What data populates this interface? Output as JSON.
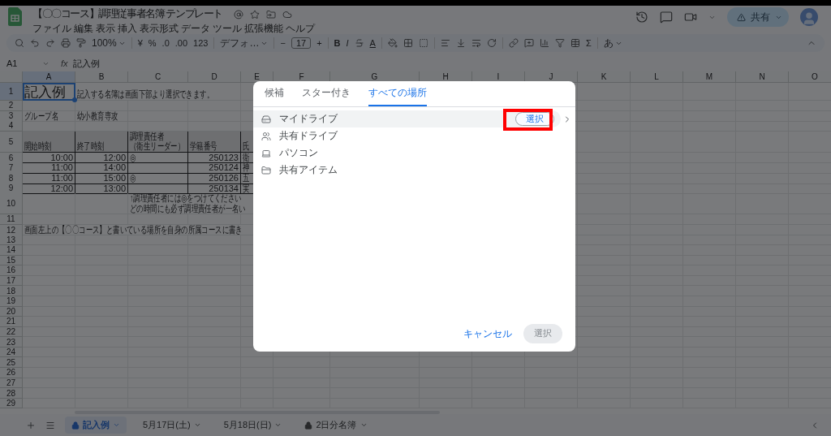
{
  "app": {
    "title": "【〇〇コース】調理従事者名簿 テンプレート",
    "menu": [
      "ファイル",
      "編集",
      "表示",
      "挿入",
      "表示形式",
      "データ",
      "ツール",
      "拡張機能",
      "ヘルプ"
    ],
    "share_button": "共有"
  },
  "toolbar": {
    "zoom": "100%",
    "currency": "¥",
    "percent": "%",
    "decimal_decrease": ".0",
    "decimal_increase": ".00",
    "number_format": "123",
    "font": "デフォ…",
    "size_decrease": "−",
    "font_size": "17",
    "size_increase": "+",
    "bold": "B",
    "italic": "I",
    "text_color": "A",
    "sum": "Σ",
    "input_tools": "あ"
  },
  "formula_bar": {
    "name_box": "A1",
    "fx": "fx",
    "value": "記入例"
  },
  "grid": {
    "columns": [
      "A",
      "B",
      "C",
      "D",
      "E",
      "F",
      "G",
      "H",
      "I",
      "J",
      "K",
      "L",
      "M",
      "N",
      "O"
    ],
    "rows": [
      {
        "number": "1",
        "kind": "plain",
        "cells": [
          {
            "kind": "title",
            "lines": [
              "記入例"
            ],
            "selected": true
          },
          {
            "kind": "text",
            "lines": [
              "記入する名簿は画面下部より選択できます。"
            ],
            "selected": false
          }
        ]
      },
      {
        "number": "2",
        "kind": "plain",
        "cells": []
      },
      {
        "number": "3",
        "kind": "plain",
        "cells": [
          {
            "kind": "text",
            "lines": [
              "グループ名"
            ],
            "selected": false
          },
          {
            "kind": "text",
            "lines": [
              "幼小教育専攻"
            ],
            "selected": false
          }
        ]
      },
      {
        "number": "4",
        "kind": "plain",
        "cells": []
      },
      {
        "number": "5",
        "kind": "table_header",
        "cells": [
          {
            "kind": "text",
            "lines": [
              "開始時刻"
            ],
            "selected": false
          },
          {
            "kind": "text",
            "lines": [
              "終了時刻"
            ],
            "selected": false
          },
          {
            "kind": "text",
            "lines": [
              "調理責任者",
              "（衛生リーダー）"
            ],
            "selected": false
          },
          {
            "kind": "text",
            "lines": [
              "学籍番号"
            ],
            "selected": false
          },
          {
            "kind": "text",
            "lines": [
              "氏"
            ],
            "selected": false
          }
        ]
      },
      {
        "number": "6",
        "kind": "table_row",
        "cells": [
          {
            "kind": "number",
            "lines": [
              "10:00"
            ],
            "selected": false
          },
          {
            "kind": "number",
            "lines": [
              "12:00"
            ],
            "selected": false
          },
          {
            "kind": "text",
            "lines": [
              "◎"
            ],
            "selected": false
          },
          {
            "kind": "number",
            "lines": [
              "250123"
            ],
            "selected": false
          },
          {
            "kind": "text",
            "lines": [
              "衛"
            ],
            "selected": false
          }
        ]
      },
      {
        "number": "7",
        "kind": "table_row",
        "cells": [
          {
            "kind": "number",
            "lines": [
              "11:00"
            ],
            "selected": false
          },
          {
            "kind": "number",
            "lines": [
              "14:00"
            ],
            "selected": false
          },
          {
            "kind": "empty",
            "selected": false
          },
          {
            "kind": "number",
            "lines": [
              "250124"
            ],
            "selected": false
          },
          {
            "kind": "text",
            "lines": [
              "神"
            ],
            "selected": false
          }
        ]
      },
      {
        "number": "8",
        "kind": "table_row",
        "cells": [
          {
            "kind": "number",
            "lines": [
              "11:00"
            ],
            "selected": false
          },
          {
            "kind": "number",
            "lines": [
              "15:00"
            ],
            "selected": false
          },
          {
            "kind": "text",
            "lines": [
              "◎"
            ],
            "selected": false
          },
          {
            "kind": "number",
            "lines": [
              "250126"
            ],
            "selected": false
          },
          {
            "kind": "text",
            "lines": [
              "五"
            ],
            "selected": false
          }
        ]
      },
      {
        "number": "9",
        "kind": "table_row",
        "cells": [
          {
            "kind": "number",
            "lines": [
              "12:00"
            ],
            "selected": false
          },
          {
            "kind": "number",
            "lines": [
              "13:00"
            ],
            "selected": false
          },
          {
            "kind": "empty",
            "selected": false
          },
          {
            "kind": "number",
            "lines": [
              "250134"
            ],
            "selected": false
          },
          {
            "kind": "text",
            "lines": [
              "実"
            ],
            "selected": false
          }
        ]
      },
      {
        "number": "10",
        "kind": "plain",
        "cells": [
          {
            "kind": "empty",
            "selected": false
          },
          {
            "kind": "empty",
            "selected": false
          },
          {
            "kind": "text",
            "lines": [
              "↑調理責任者には◎をつけてください",
              "どの時間にも必ず調理責任者が一名い"
            ],
            "selected": false
          }
        ]
      },
      {
        "number": "11",
        "kind": "plain",
        "cells": []
      },
      {
        "number": "12",
        "kind": "plain",
        "cells": [
          {
            "kind": "text",
            "lines": [
              "画面左上の【〇〇コース】と書いている場所を自身の所属コースに書き"
            ],
            "selected": false
          }
        ]
      },
      {
        "number": "13",
        "kind": "plain",
        "cells": []
      },
      {
        "number": "14",
        "kind": "plain",
        "cells": []
      },
      {
        "number": "15",
        "kind": "plain",
        "cells": []
      },
      {
        "number": "16",
        "kind": "plain",
        "cells": []
      },
      {
        "number": "17",
        "kind": "plain",
        "cells": []
      },
      {
        "number": "18",
        "kind": "plain",
        "cells": []
      },
      {
        "number": "19",
        "kind": "plain",
        "cells": []
      },
      {
        "number": "20",
        "kind": "plain",
        "cells": []
      },
      {
        "number": "21",
        "kind": "plain",
        "cells": []
      },
      {
        "number": "22",
        "kind": "plain",
        "cells": []
      },
      {
        "number": "23",
        "kind": "plain",
        "cells": []
      },
      {
        "number": "24",
        "kind": "plain",
        "cells": []
      },
      {
        "number": "25",
        "kind": "plain",
        "cells": []
      },
      {
        "number": "26",
        "kind": "plain",
        "cells": []
      },
      {
        "number": "27",
        "kind": "plain",
        "cells": []
      },
      {
        "number": "28",
        "kind": "plain",
        "cells": []
      },
      {
        "number": "29",
        "kind": "plain",
        "cells": []
      }
    ]
  },
  "sheet_tabs": [
    {
      "label": "記入例",
      "locked": true,
      "selected": true
    },
    {
      "label": "5月17日(土)",
      "locked": false,
      "selected": false
    },
    {
      "label": "5月18日(日)",
      "locked": false,
      "selected": false
    },
    {
      "label": "2日分名簿",
      "locked": true,
      "selected": false
    }
  ],
  "dialog": {
    "tabs": [
      {
        "label": "候補",
        "selected": false
      },
      {
        "label": "スター付き",
        "selected": false
      },
      {
        "label": "すべての場所",
        "selected": true
      }
    ],
    "locations": [
      {
        "kind": "my_drive",
        "label": "マイドライブ",
        "selected": true,
        "action": "選択"
      },
      {
        "kind": "shared_drive",
        "label": "共有ドライブ",
        "selected": false
      },
      {
        "kind": "computer",
        "label": "パソコン",
        "selected": false
      },
      {
        "kind": "shared_item",
        "label": "共有アイテム",
        "selected": false
      }
    ],
    "cancel": "キャンセル",
    "confirm": {
      "label": "選択",
      "disabled": true
    }
  }
}
